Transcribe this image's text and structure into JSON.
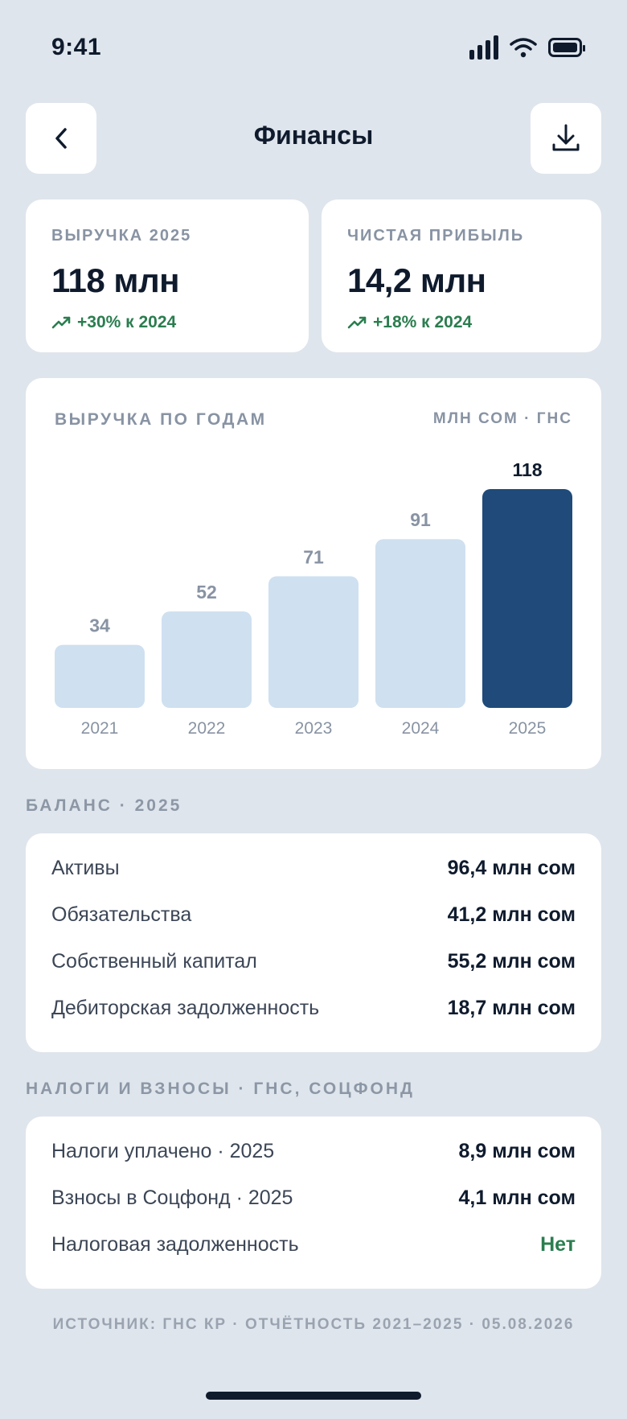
{
  "status": {
    "time": "9:41",
    "icons": [
      "signal-icon",
      "wifi-icon",
      "battery-icon"
    ]
  },
  "header": {
    "title": "Финансы",
    "back_icon": "chevron-left-icon",
    "download_icon": "download-icon"
  },
  "kpis": [
    {
      "label": "ВЫРУЧКА 2025",
      "value": "118 млн",
      "delta": "+30% к 2024"
    },
    {
      "label": "ЧИСТАЯ ПРИБЫЛЬ",
      "value": "14,2 млн",
      "delta": "+18% к 2024"
    }
  ],
  "chart": {
    "title": "ВЫРУЧКА ПО ГОДАМ",
    "unit": "МЛН СОМ · ГНС"
  },
  "chart_data": {
    "type": "bar",
    "categories": [
      "2021",
      "2022",
      "2023",
      "2024",
      "2025"
    ],
    "values": [
      34,
      52,
      71,
      91,
      118
    ],
    "data_labels": [
      "34",
      "52",
      "71",
      "91",
      "118"
    ],
    "title": "ВЫРУЧКА ПО ГОДАМ",
    "unit": "МЛН СОМ · ГНС",
    "highlight_index": 4,
    "colors": {
      "bar": "#cfe0f0",
      "highlight": "#1f4a7a"
    },
    "grid": false
  },
  "balance": {
    "section": "БАЛАНС · 2025",
    "rows": [
      {
        "label": "Активы",
        "value": "96,4 млн сом"
      },
      {
        "label": "Обязательства",
        "value": "41,2 млн сом"
      },
      {
        "label": "Собственный капитал",
        "value": "55,2 млн сом"
      },
      {
        "label": "Дебиторская задолженность",
        "value": "18,7 млн сом"
      }
    ]
  },
  "taxes": {
    "section": "НАЛОГИ И ВЗНОСЫ · ГНС, СОЦФОНД",
    "rows": [
      {
        "label": "Налоги уплачено · 2025",
        "value": "8,9 млн сом"
      },
      {
        "label": "Взносы в Соцфонд · 2025",
        "value": "4,1 млн сом"
      },
      {
        "label": "Налоговая задолженность",
        "value": "Нет"
      }
    ]
  },
  "footer": "ИСТОЧНИК: ГНС КР · ОТЧЁТНОСТЬ 2021–2025 · 05.08.2026",
  "colors": {
    "accent": "#1f4a7a",
    "positive": "#2a7d4f",
    "background": "#dfe5ec"
  }
}
